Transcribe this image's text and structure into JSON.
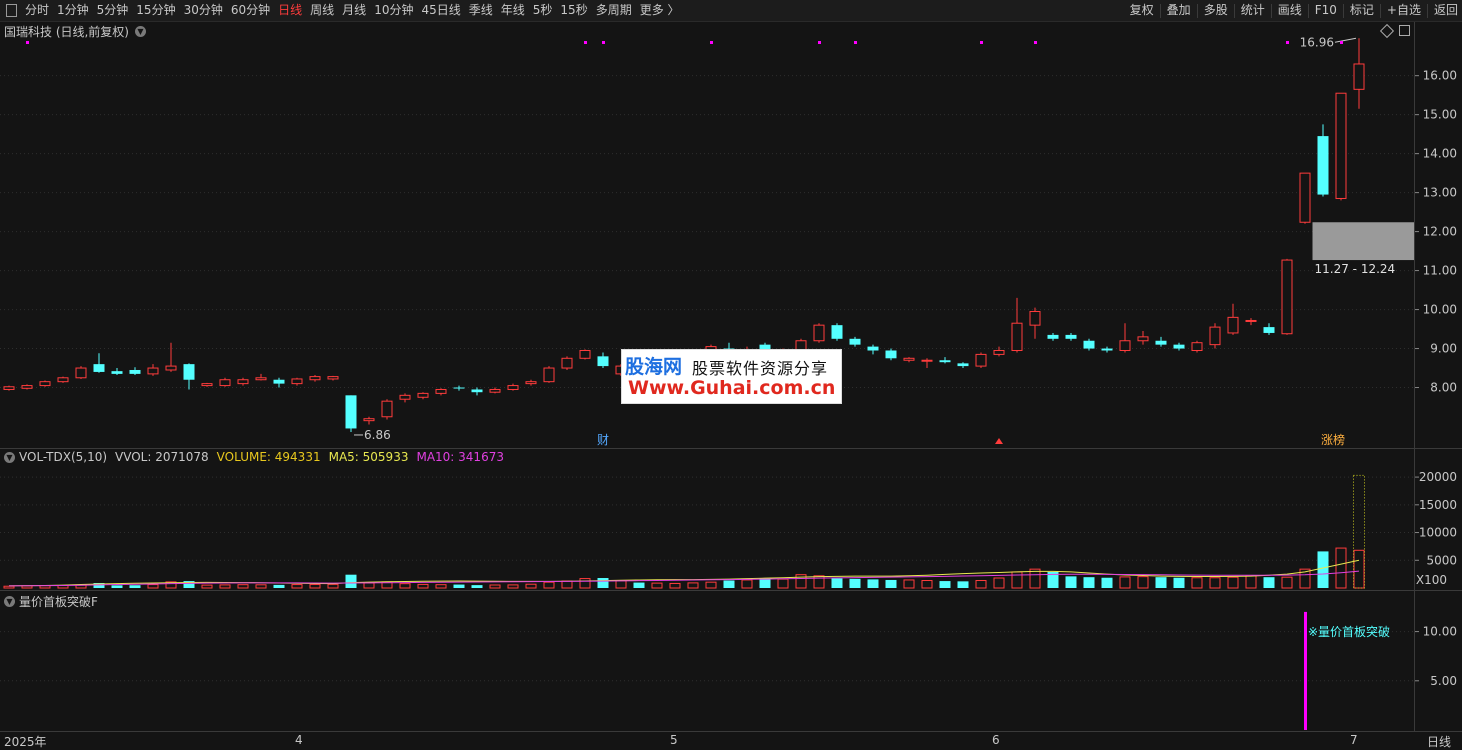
{
  "toolbar": {
    "periods": [
      "分时",
      "1分钟",
      "5分钟",
      "15分钟",
      "30分钟",
      "60分钟",
      "日线",
      "周线",
      "月线",
      "10分钟",
      "45日线",
      "季线",
      "年线",
      "5秒",
      "15秒",
      "多周期",
      "更多 〉"
    ],
    "active_period": "日线",
    "actions": [
      "复权",
      "叠加",
      "多股",
      "统计",
      "画线",
      "F10",
      "标记",
      "+自选",
      "返回"
    ]
  },
  "main_chart": {
    "title": "国瑞科技 (日线,前复权)",
    "price_ticks": [
      "16.00",
      "15.00",
      "14.00",
      "13.00",
      "12.00",
      "11.00",
      "10.00",
      "9.00",
      "8.00"
    ],
    "high_label": "16.96",
    "low_label": "6.86",
    "zone_label": "11.27 - 12.24",
    "marker_cai": "财",
    "marker_zhangbang": "涨榜"
  },
  "volume_panel": {
    "name": "VOL-TDX(5,10)",
    "vvol": "VVOL: 2071078",
    "volume": "VOLUME: 494331",
    "ma5": "MA5: 505933",
    "ma10": "MA10: 341673",
    "ticks": [
      "20000",
      "15000",
      "10000",
      "5000"
    ],
    "unit": "X100"
  },
  "indicator_panel": {
    "name": "量价首板突破F",
    "signal_label": "※量价首板突破",
    "ticks": [
      "10.00",
      "5.00"
    ]
  },
  "x_axis": {
    "labels": [
      "2025年",
      "4",
      "5",
      "6",
      "7"
    ],
    "period": "日线"
  },
  "watermark": {
    "brand": "股海网",
    "slogan": "股票软件资源分享",
    "url": "Www.Guhai.com.cn"
  },
  "colors": {
    "up": "#ff3c3c",
    "down": "#54ffff",
    "ma5": "#e8e850",
    "ma10": "#e040e0",
    "signal": "#ff00ff",
    "zone": "#9a9a9a"
  },
  "chart_data": {
    "type": "candlestick",
    "ohlc": [
      [
        7.95,
        8.05,
        7.92,
        8.02
      ],
      [
        7.98,
        8.08,
        7.95,
        8.05
      ],
      [
        8.05,
        8.18,
        8.02,
        8.15
      ],
      [
        8.15,
        8.28,
        8.12,
        8.25
      ],
      [
        8.25,
        8.55,
        8.22,
        8.5
      ],
      [
        8.6,
        8.88,
        8.38,
        8.4
      ],
      [
        8.42,
        8.5,
        8.32,
        8.35
      ],
      [
        8.45,
        8.52,
        8.32,
        8.35
      ],
      [
        8.35,
        8.6,
        8.3,
        8.5
      ],
      [
        8.45,
        9.15,
        8.4,
        8.55
      ],
      [
        8.6,
        8.62,
        7.95,
        8.2
      ],
      [
        8.05,
        8.12,
        8.02,
        8.1
      ],
      [
        8.05,
        8.25,
        8.02,
        8.2
      ],
      [
        8.1,
        8.25,
        8.05,
        8.2
      ],
      [
        8.2,
        8.35,
        8.18,
        8.25
      ],
      [
        8.2,
        8.25,
        8.0,
        8.1
      ],
      [
        8.1,
        8.25,
        8.05,
        8.22
      ],
      [
        8.2,
        8.32,
        8.15,
        8.28
      ],
      [
        8.22,
        8.3,
        8.18,
        8.28
      ],
      [
        7.8,
        7.8,
        6.86,
        6.95
      ],
      [
        7.15,
        7.25,
        7.05,
        7.2
      ],
      [
        7.25,
        7.7,
        7.18,
        7.65
      ],
      [
        7.7,
        7.85,
        7.62,
        7.8
      ],
      [
        7.75,
        7.88,
        7.7,
        7.85
      ],
      [
        7.85,
        7.98,
        7.8,
        7.95
      ],
      [
        8.0,
        8.05,
        7.92,
        7.98
      ],
      [
        7.95,
        8.0,
        7.8,
        7.88
      ],
      [
        7.88,
        8.0,
        7.85,
        7.95
      ],
      [
        7.95,
        8.1,
        7.92,
        8.05
      ],
      [
        8.1,
        8.2,
        8.05,
        8.15
      ],
      [
        8.15,
        8.55,
        8.12,
        8.5
      ],
      [
        8.5,
        8.8,
        8.45,
        8.75
      ],
      [
        8.75,
        8.98,
        8.72,
        8.95
      ],
      [
        8.8,
        8.9,
        8.5,
        8.55
      ],
      [
        8.35,
        8.6,
        8.3,
        8.55
      ],
      [
        8.55,
        8.7,
        8.4,
        8.5
      ],
      [
        8.45,
        8.65,
        8.4,
        8.6
      ],
      [
        8.6,
        8.75,
        8.55,
        8.7
      ],
      [
        8.7,
        8.9,
        8.65,
        8.85
      ],
      [
        8.85,
        9.1,
        8.8,
        9.05
      ],
      [
        9.0,
        9.15,
        8.85,
        8.9
      ],
      [
        8.9,
        9.05,
        8.8,
        8.95
      ],
      [
        9.1,
        9.15,
        8.8,
        8.85
      ],
      [
        8.85,
        9.0,
        8.75,
        8.95
      ],
      [
        8.95,
        9.25,
        8.9,
        9.2
      ],
      [
        9.2,
        9.65,
        9.15,
        9.6
      ],
      [
        9.6,
        9.65,
        9.2,
        9.25
      ],
      [
        9.25,
        9.3,
        9.05,
        9.1
      ],
      [
        9.05,
        9.1,
        8.85,
        8.95
      ],
      [
        8.95,
        9.0,
        8.7,
        8.75
      ],
      [
        8.7,
        8.78,
        8.65,
        8.75
      ],
      [
        8.7,
        8.75,
        8.5,
        8.7
      ],
      [
        8.7,
        8.78,
        8.62,
        8.65
      ],
      [
        8.62,
        8.65,
        8.5,
        8.55
      ],
      [
        8.55,
        8.9,
        8.5,
        8.85
      ],
      [
        8.85,
        9.05,
        8.8,
        8.95
      ],
      [
        8.95,
        10.3,
        8.9,
        9.65
      ],
      [
        9.6,
        10.05,
        9.25,
        9.95
      ],
      [
        9.35,
        9.4,
        9.2,
        9.25
      ],
      [
        9.35,
        9.4,
        9.2,
        9.25
      ],
      [
        9.2,
        9.25,
        8.95,
        9.0
      ],
      [
        9.0,
        9.05,
        8.9,
        8.95
      ],
      [
        8.95,
        9.65,
        8.9,
        9.2
      ],
      [
        9.2,
        9.45,
        9.1,
        9.3
      ],
      [
        9.2,
        9.3,
        9.05,
        9.1
      ],
      [
        9.1,
        9.15,
        8.95,
        9.0
      ],
      [
        8.95,
        9.2,
        8.9,
        9.15
      ],
      [
        9.1,
        9.65,
        9.0,
        9.55
      ],
      [
        9.4,
        10.15,
        9.35,
        9.8
      ],
      [
        9.7,
        9.78,
        9.6,
        9.72
      ],
      [
        9.55,
        9.65,
        9.35,
        9.4
      ],
      [
        9.38,
        11.3,
        9.35,
        11.27
      ],
      [
        12.24,
        13.5,
        12.2,
        13.5
      ],
      [
        14.45,
        14.75,
        12.9,
        12.95
      ],
      [
        12.85,
        15.55,
        12.8,
        15.55
      ],
      [
        15.65,
        16.96,
        15.15,
        16.3
      ]
    ],
    "volume": [
      320,
      380,
      420,
      450,
      520,
      900,
      480,
      500,
      620,
      1100,
      1250,
      520,
      560,
      600,
      580,
      560,
      620,
      640,
      660,
      2400,
      900,
      1100,
      780,
      650,
      600,
      620,
      520,
      540,
      560,
      680,
      1050,
      1250,
      1700,
      1800,
      1300,
      980,
      880,
      820,
      920,
      1050,
      1350,
      1450,
      1700,
      1600,
      2400,
      2200,
      1750,
      1650,
      1550,
      1450,
      1450,
      1350,
      1250,
      1200,
      1350,
      1800,
      2900,
      3400,
      2900,
      2100,
      1950,
      1850,
      2000,
      2050,
      1950,
      1850,
      1850,
      1850,
      1950,
      2250,
      1950,
      1950,
      3400,
      6600,
      7200,
      6800
    ],
    "ma5": [
      400,
      430,
      460,
      520,
      620,
      720,
      800,
      860,
      900,
      950,
      1000,
      1020,
      1000,
      980,
      950,
      900,
      860,
      820,
      800,
      980,
      1050,
      1130,
      1180,
      1220,
      1250,
      1260,
      1240,
      1220,
      1200,
      1190,
      1200,
      1220,
      1260,
      1320,
      1400,
      1450,
      1480,
      1500,
      1520,
      1550,
      1600,
      1680,
      1780,
      1850,
      1950,
      2050,
      2100,
      2150,
      2150,
      2150,
      2200,
      2300,
      2450,
      2600,
      2700,
      2800,
      2900,
      3000,
      3000,
      2900,
      2700,
      2500,
      2350,
      2250,
      2150,
      2100,
      2080,
      2080,
      2100,
      2150,
      2300,
      2500,
      2900,
      3600,
      4300,
      5000
    ],
    "ma10": [
      380,
      400,
      420,
      450,
      500,
      560,
      620,
      680,
      730,
      780,
      830,
      870,
      900,
      920,
      930,
      930,
      920,
      900,
      890,
      900,
      920,
      950,
      980,
      1010,
      1040,
      1070,
      1090,
      1110,
      1130,
      1150,
      1170,
      1190,
      1210,
      1240,
      1280,
      1320,
      1360,
      1400,
      1440,
      1480,
      1520,
      1560,
      1610,
      1660,
      1720,
      1780,
      1830,
      1880,
      1920,
      1960,
      2000,
      2050,
      2100,
      2160,
      2220,
      2280,
      2340,
      2400,
      2450,
      2480,
      2480,
      2460,
      2440,
      2410,
      2380,
      2350,
      2320,
      2300,
      2290,
      2290,
      2300,
      2320,
      2380,
      2520,
      2750,
      3050
    ],
    "signal_index": 72,
    "signal_value": 12.0,
    "price_range": [
      6.5,
      17.3
    ],
    "volume_range": [
      0,
      22000
    ],
    "indicator_range": [
      0,
      12.6
    ],
    "zone": [
      11.27,
      12.24
    ]
  }
}
